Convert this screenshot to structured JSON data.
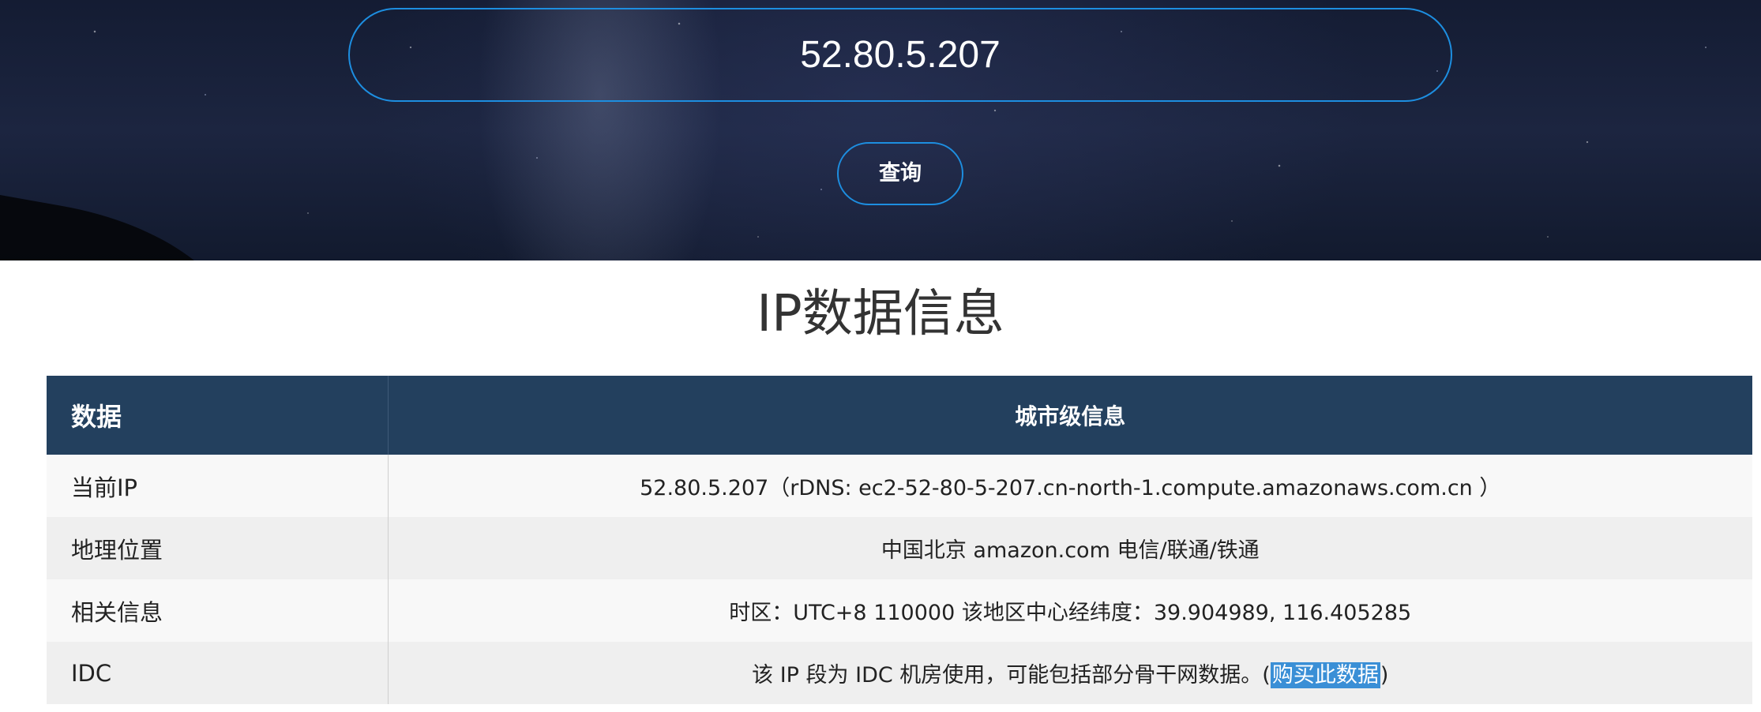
{
  "search": {
    "ip_value": "52.80.5.207",
    "query_button_label": "查询"
  },
  "section": {
    "title": "IP数据信息"
  },
  "table": {
    "headers": [
      "数据",
      "城市级信息"
    ],
    "rows": [
      {
        "label": "当前IP",
        "value": "52.80.5.207（rDNS: ec2-52-80-5-207.cn-north-1.compute.amazonaws.com.cn ）"
      },
      {
        "label": "地理位置",
        "value": "中国北京 amazon.com 电信/联通/铁通"
      },
      {
        "label": "相关信息",
        "value": "时区：UTC+8 110000 该地区中心经纬度：39.904989, 116.405285"
      },
      {
        "label": "IDC",
        "value_prefix": "该 IP 段为 IDC 机房使用，可能包括部分骨干网数据。(",
        "link_label": "购买此数据",
        "value_suffix": ")"
      }
    ]
  },
  "colors": {
    "accent_border": "#1d8ee0",
    "table_header_bg": "#23405e",
    "link_highlight": "#3a8fd6"
  }
}
